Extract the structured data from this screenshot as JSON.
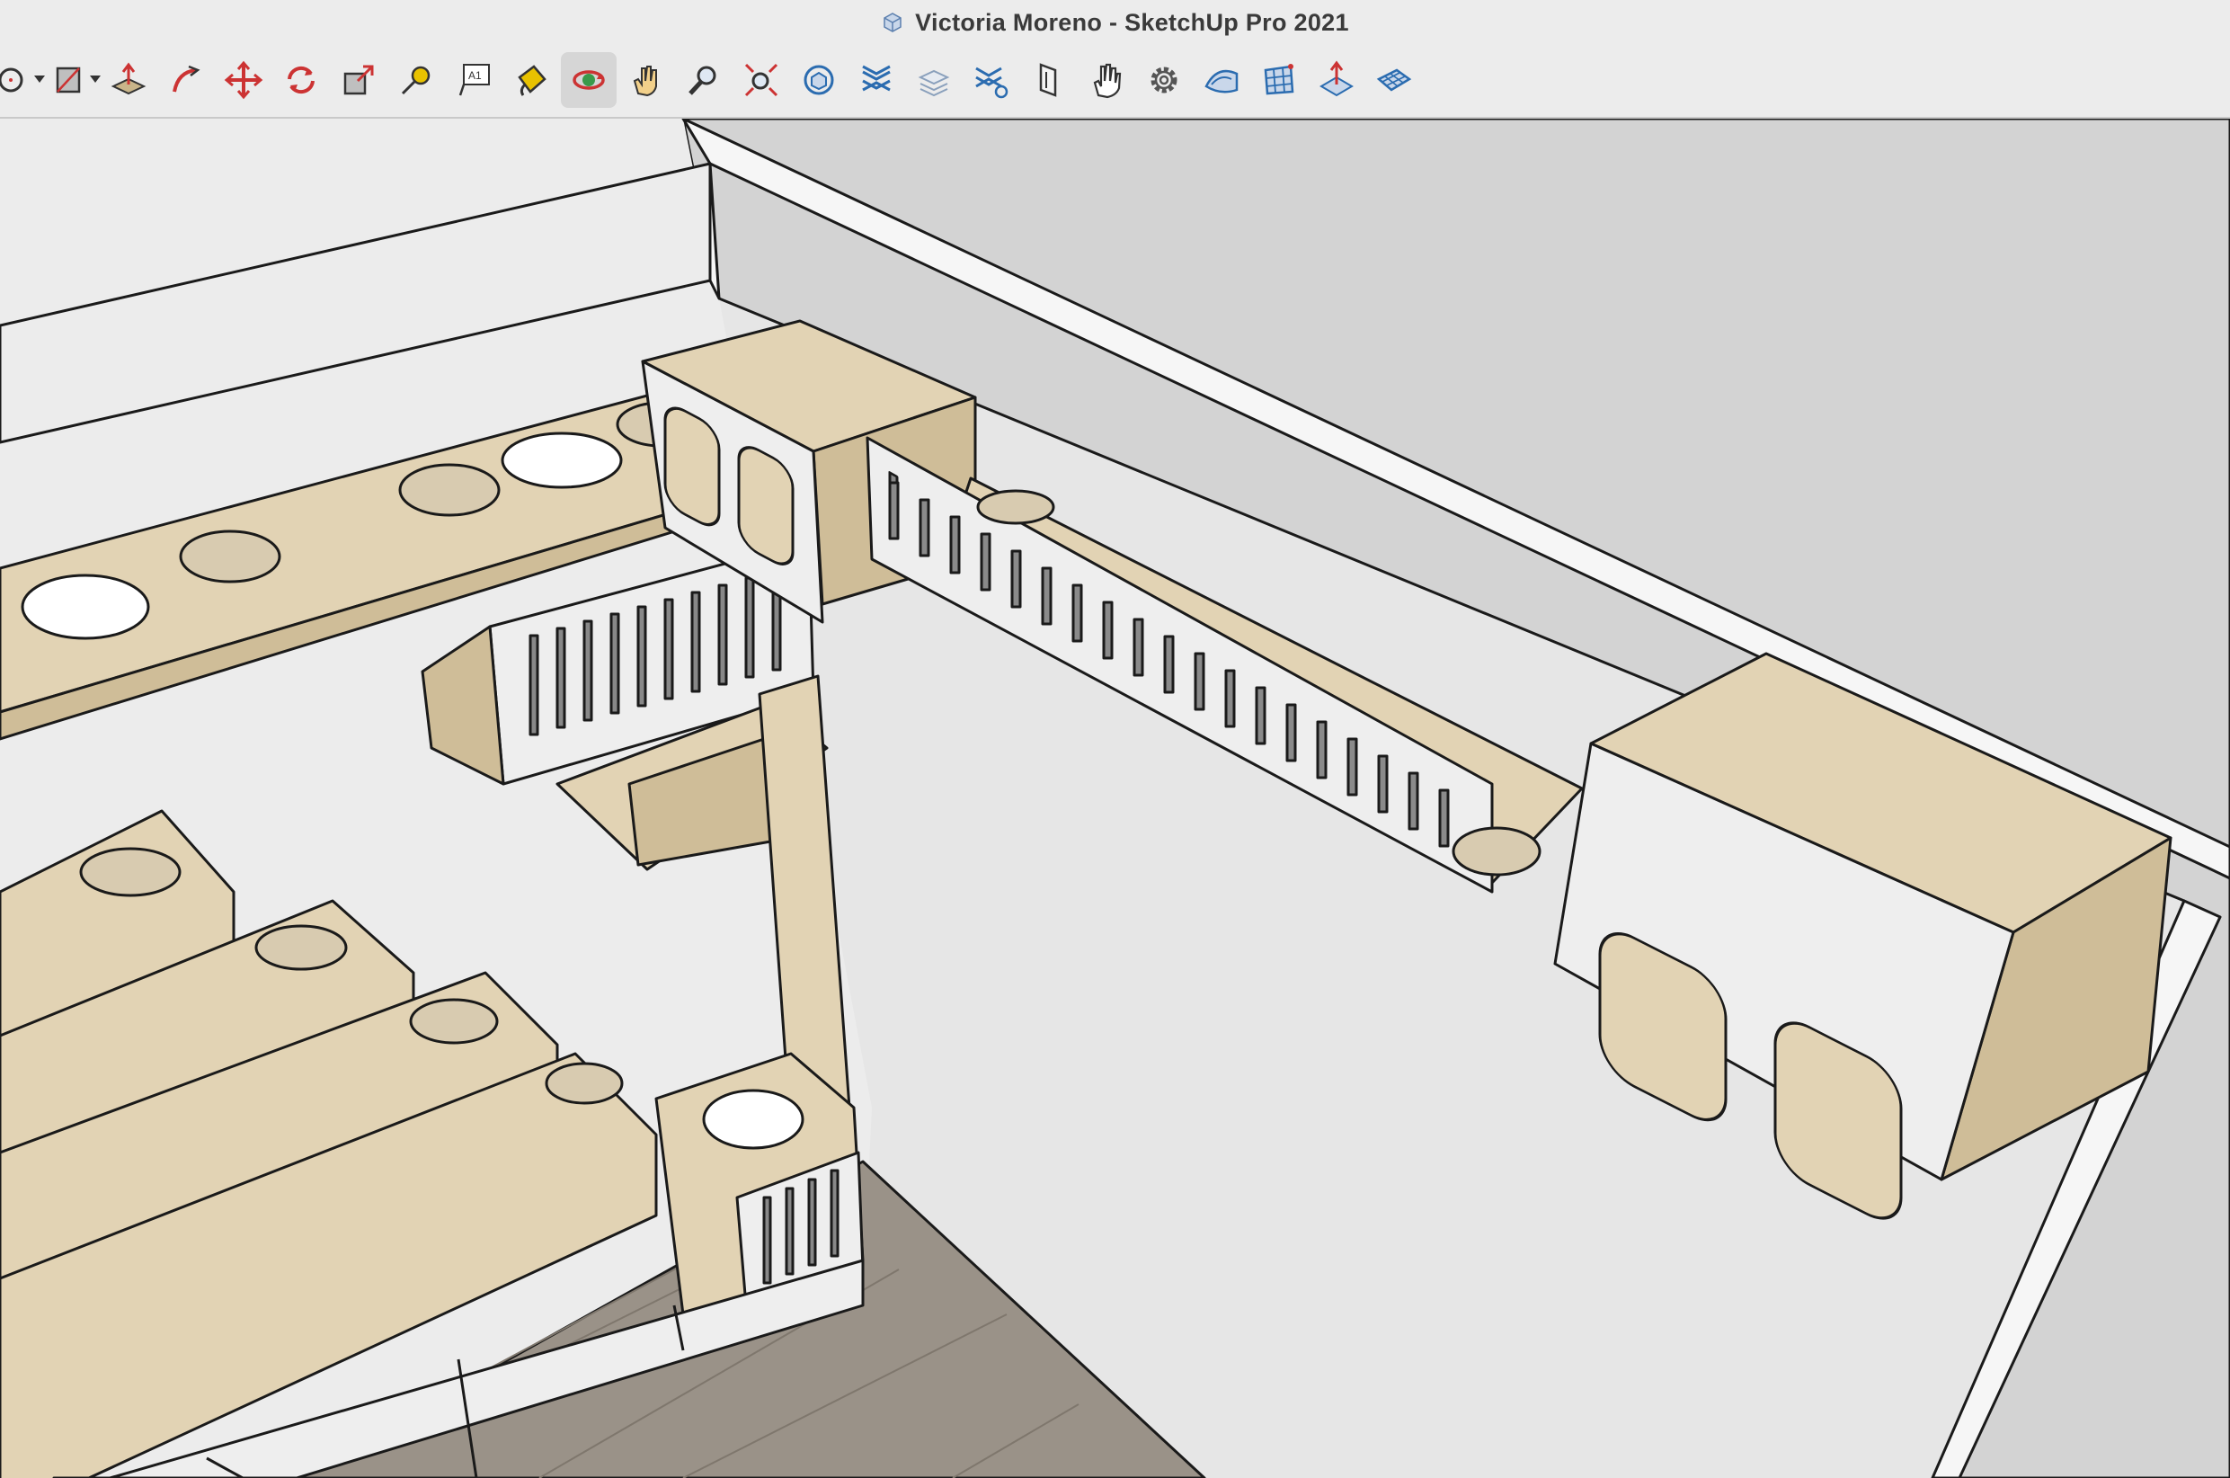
{
  "window": {
    "title": "Victoria Moreno - SketchUp Pro 2021",
    "app_icon": "sketchup-icon"
  },
  "toolbar": {
    "tools": [
      {
        "name": "circle-tool",
        "icon": "circle-icon",
        "has_dropdown": true
      },
      {
        "name": "rotated-rectangle-tool",
        "icon": "rectangle-icon",
        "has_dropdown": true
      },
      {
        "name": "push-pull-tool",
        "icon": "push-pull-icon"
      },
      {
        "name": "follow-me-tool",
        "icon": "follow-me-icon"
      },
      {
        "name": "move-tool",
        "icon": "move-icon"
      },
      {
        "name": "rotate-tool",
        "icon": "rotate-icon"
      },
      {
        "name": "scale-tool",
        "icon": "scale-icon"
      },
      {
        "name": "tape-measure-tool",
        "icon": "tape-measure-icon"
      },
      {
        "name": "text-tool",
        "icon": "text-icon",
        "glyph": "A1"
      },
      {
        "name": "paint-bucket-tool",
        "icon": "paint-bucket-icon"
      },
      {
        "name": "orbit-tool",
        "icon": "orbit-icon",
        "active": true
      },
      {
        "name": "pan-tool",
        "icon": "pan-hand-icon"
      },
      {
        "name": "zoom-tool",
        "icon": "zoom-icon"
      },
      {
        "name": "zoom-extents-tool",
        "icon": "zoom-extents-icon"
      },
      {
        "name": "3d-warehouse-tool",
        "icon": "warehouse-icon"
      },
      {
        "name": "extension-warehouse-tool",
        "icon": "extension-icon"
      },
      {
        "name": "layers-tool",
        "icon": "layers-icon"
      },
      {
        "name": "extension-manager-tool",
        "icon": "extension-manager-icon"
      },
      {
        "name": "section-plane-tool",
        "icon": "section-plane-icon"
      },
      {
        "name": "interact-tool",
        "icon": "hand-icon"
      },
      {
        "name": "settings-tool",
        "icon": "gear-icon"
      },
      {
        "name": "sandbox-from-contours-tool",
        "icon": "sandbox-contours-icon"
      },
      {
        "name": "sandbox-from-scratch-tool",
        "icon": "sandbox-scratch-icon"
      },
      {
        "name": "sandbox-smoove-tool",
        "icon": "smoove-icon"
      },
      {
        "name": "sandbox-drape-tool",
        "icon": "drape-icon"
      }
    ]
  },
  "viewport": {
    "description_colors": {
      "wall_light": "#ececec",
      "wall_side": "#d3d3d3",
      "plywood_face": "#e2d3b4",
      "plywood_dark": "#cfbd98",
      "panel_white": "#eeeeee",
      "floor_tile": "#9a9288",
      "cushion": "#d8cbb0",
      "edge": "#1a1a1a"
    }
  }
}
